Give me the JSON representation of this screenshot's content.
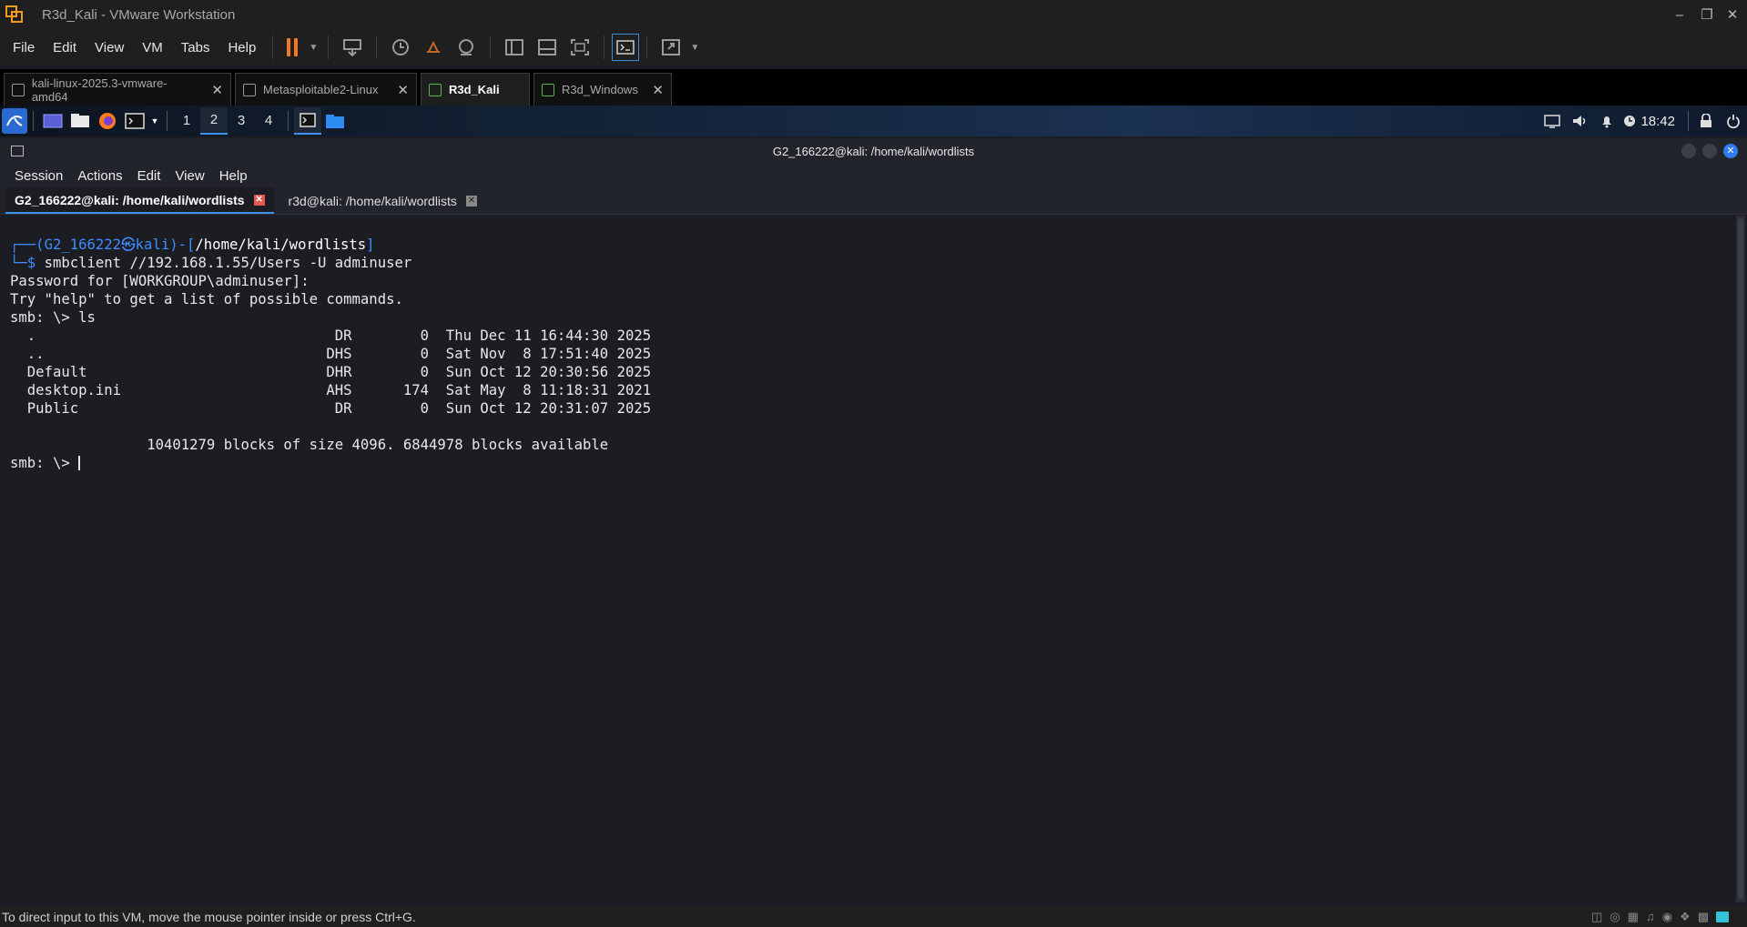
{
  "window": {
    "title": "R3d_Kali - VMware Workstation"
  },
  "vm_menu": [
    "File",
    "Edit",
    "View",
    "VM",
    "Tabs",
    "Help"
  ],
  "vm_tabs": [
    {
      "label": "kali-linux-2025.3-vmware-amd64",
      "active": false
    },
    {
      "label": "Metasploitable2-Linux",
      "active": false
    },
    {
      "label": "R3d_Kali",
      "active": true
    },
    {
      "label": "R3d_Windows",
      "active": false
    }
  ],
  "kali_panel": {
    "workspaces": [
      "1",
      "2",
      "3",
      "4"
    ],
    "active_workspace": "2",
    "clock": "18:42"
  },
  "terminal": {
    "title": "G2_166222@kali: /home/kali/wordlists",
    "menu": [
      "Session",
      "Actions",
      "Edit",
      "View",
      "Help"
    ],
    "tabs": [
      {
        "label": "G2_166222@kali: /home/kali/wordlists",
        "active": true
      },
      {
        "label": "r3d@kali: /home/kali/wordlists",
        "active": false
      }
    ],
    "prompt": {
      "user": "G2_166222",
      "host": "kali",
      "path": "/home/kali/wordlists"
    },
    "lines": {
      "command": "smbclient //192.168.1.55/Users -U adminuser",
      "password": "Password for [WORKGROUP\\adminuser]:",
      "help": "Try \"help\" to get a list of possible commands.",
      "ls_cmd": "smb: \\> ls",
      "listing": [
        "  .                                   DR        0  Thu Dec 11 16:44:30 2025",
        "  ..                                 DHS        0  Sat Nov  8 17:51:40 2025",
        "  Default                            DHR        0  Sun Oct 12 20:30:56 2025",
        "  desktop.ini                        AHS      174  Sat May  8 11:18:31 2021",
        "  Public                              DR        0  Sun Oct 12 20:31:07 2025"
      ],
      "blocks": "                10401279 blocks of size 4096. 6844978 blocks available",
      "final_prompt": "smb: \\> "
    }
  },
  "status_bar": {
    "text": "To direct input to this VM, move the mouse pointer inside or press Ctrl+G."
  },
  "colors": {
    "accent": "#3d8ff0",
    "pause": "#f0781e",
    "vmware_logo": "#f29a1e",
    "terminal_bg": "#1b1d22"
  }
}
